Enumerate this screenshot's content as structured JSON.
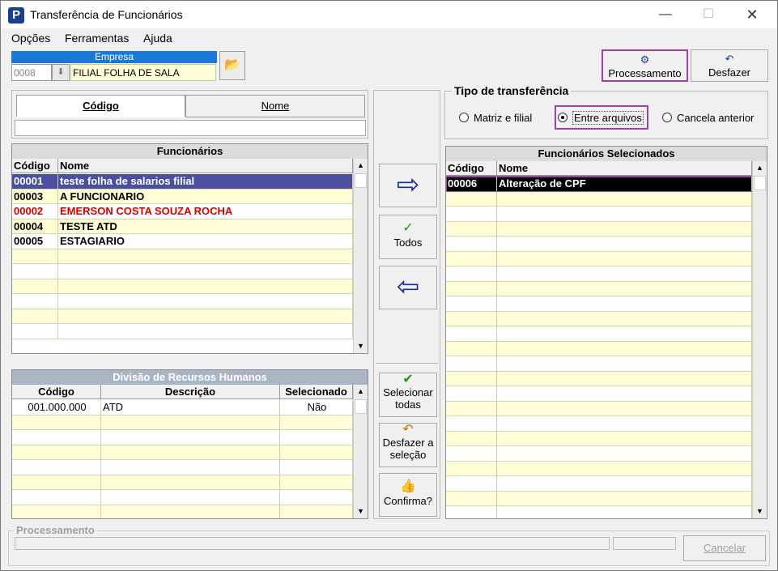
{
  "window": {
    "title": "Transferência de Funcionários"
  },
  "menu": [
    "Opções",
    "Ferramentas",
    "Ajuda"
  ],
  "empresa": {
    "label": "Empresa",
    "code": "0008",
    "name": "FILIAL FOLHA DE SALA"
  },
  "toolbar": {
    "processamento": "Processamento",
    "desfazer": "Desfazer"
  },
  "search": {
    "tab_codigo": "Código",
    "tab_nome": "Nome",
    "value": ""
  },
  "funcionarios": {
    "title": "Funcionários",
    "headers": [
      "Código",
      "Nome"
    ],
    "rows": [
      {
        "codigo": "00001",
        "nome": "teste folha de salarios filial"
      },
      {
        "codigo": "00003",
        "nome": "A FUNCIONARIO"
      },
      {
        "codigo": "00002",
        "nome": "EMERSON COSTA SOUZA ROCHA"
      },
      {
        "codigo": "00004",
        "nome": "TESTE ATD"
      },
      {
        "codigo": "00005",
        "nome": "ESTAGIARIO"
      }
    ]
  },
  "divisao": {
    "title": "Divisão de Recursos Humanos",
    "headers": [
      "Código",
      "Descrição",
      "Selecionado"
    ],
    "rows": [
      {
        "codigo": "001.000.000",
        "descricao": "ATD",
        "selecionado": "Não"
      }
    ]
  },
  "middle": {
    "todos": "Todos",
    "selecionar_todas": "Selecionar todas",
    "desfazer_selecao": "Desfazer a seleção",
    "confirma": "Confirma?"
  },
  "tipo": {
    "legend": "Tipo de transferência",
    "opcoes": [
      "Matriz e filial",
      "Entre arquivos",
      "Cancela anterior"
    ],
    "selected": "Entre arquivos"
  },
  "selecionados": {
    "title": "Funcionários Selecionados",
    "headers": [
      "Código",
      "Nome"
    ],
    "rows": [
      {
        "codigo": "00006",
        "nome": "Alteração de CPF"
      }
    ]
  },
  "processamento": {
    "legend": "Processamento",
    "cancel": "Cancelar"
  }
}
